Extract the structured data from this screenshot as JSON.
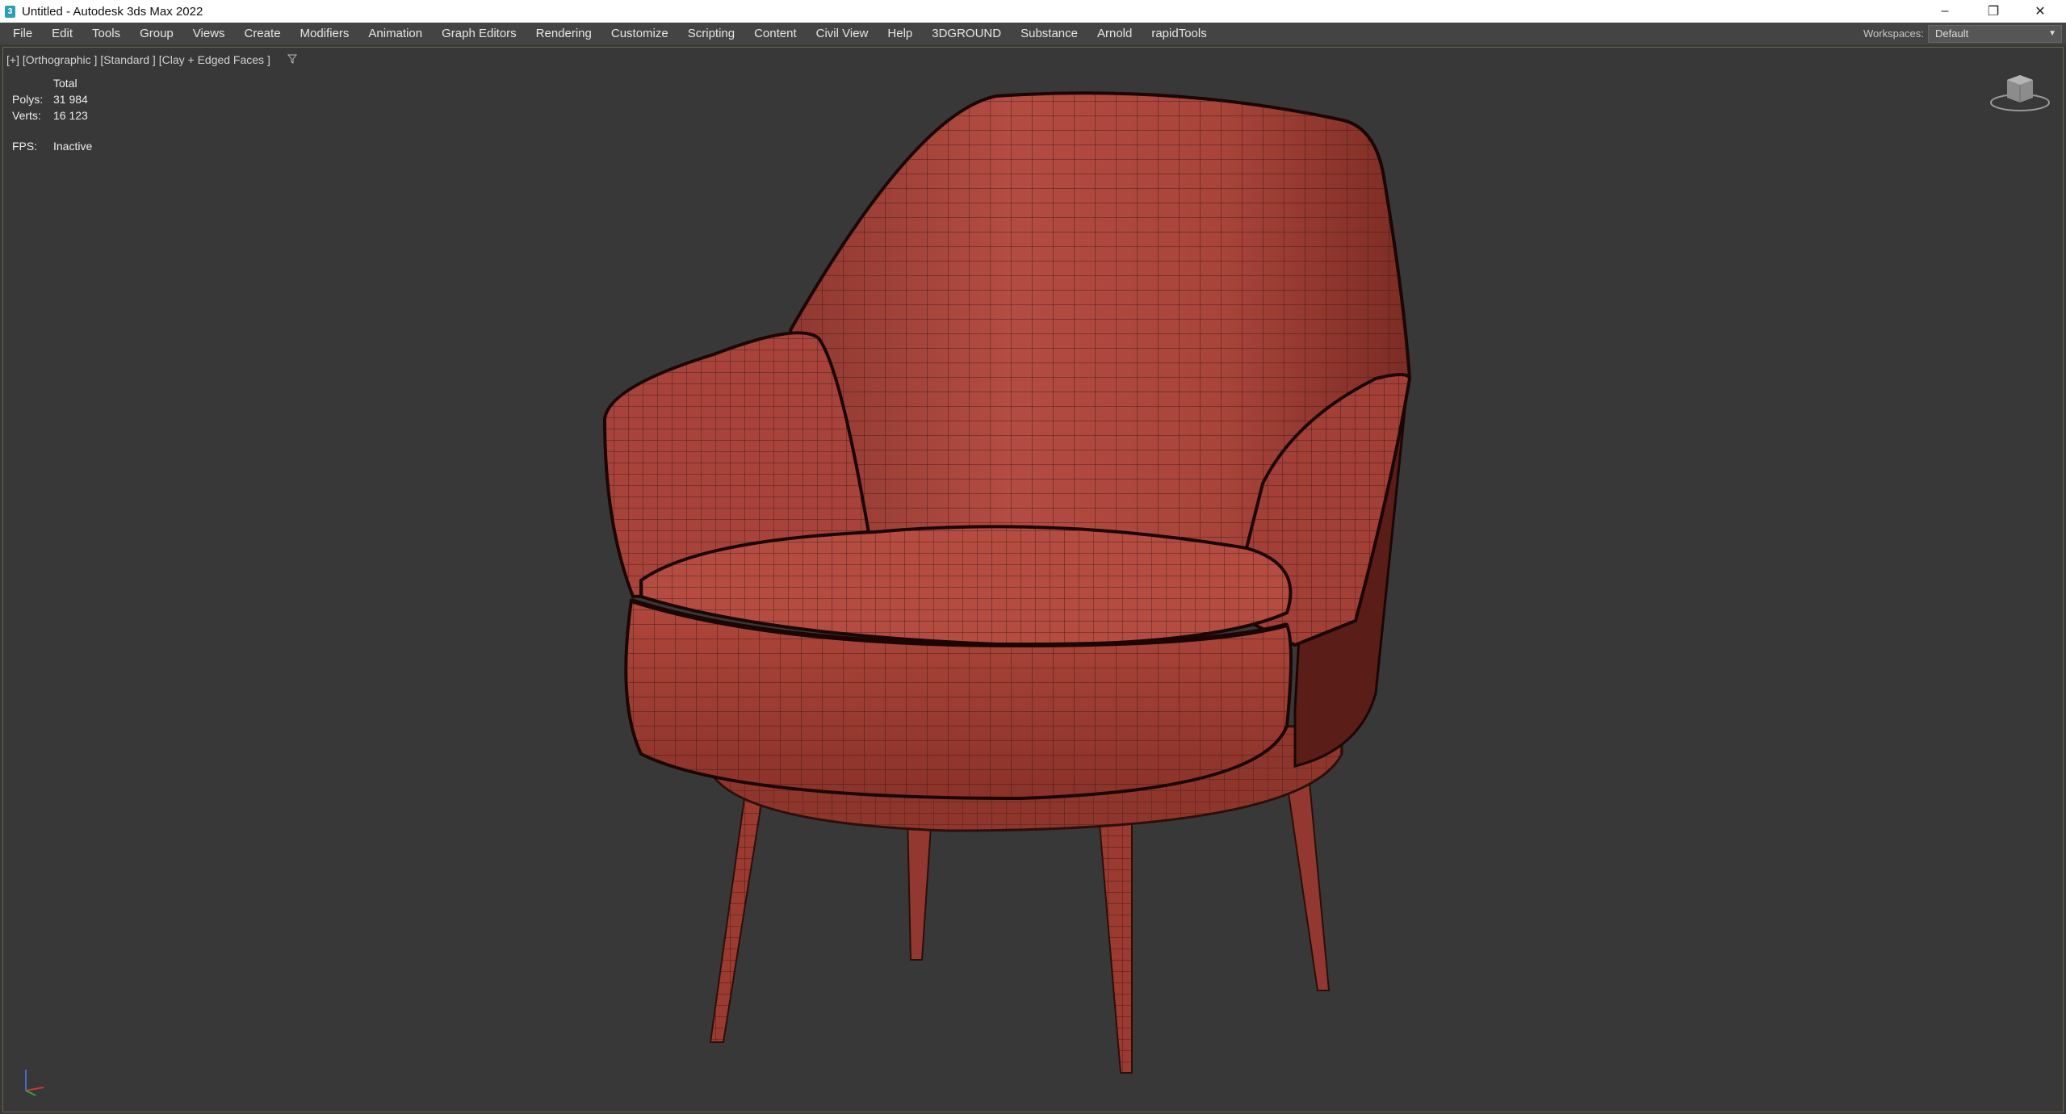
{
  "window": {
    "title": "Untitled - Autodesk 3ds Max 2022",
    "controls": {
      "minimize": "–",
      "restore": "❐",
      "close": "✕"
    }
  },
  "menu": [
    "File",
    "Edit",
    "Tools",
    "Group",
    "Views",
    "Create",
    "Modifiers",
    "Animation",
    "Graph Editors",
    "Rendering",
    "Customize",
    "Scripting",
    "Content",
    "Civil View",
    "Help",
    "3DGROUND",
    "Substance",
    "Arnold",
    "rapidTools"
  ],
  "workspaces": {
    "label": "Workspaces:",
    "value": "Default"
  },
  "viewport": {
    "label": "[+] [Orthographic ] [Standard ] [Clay + Edged Faces ]",
    "stats": {
      "header": "Total",
      "polys_label": "Polys:",
      "polys_value": "31 984",
      "verts_label": "Verts:",
      "verts_value": "16 123",
      "fps_label": "FPS:",
      "fps_value": "Inactive"
    }
  },
  "icons": [
    "app-icon",
    "filter-icon",
    "viewcube-icon",
    "axis-tripod-icon",
    "chevron-down-icon"
  ],
  "colors": {
    "viewport_bg": "#383838",
    "menubar_bg": "#444444",
    "mesh_fill": "#a8443a",
    "mesh_wire": "#2a0f0b",
    "active_border": "#6b6542"
  }
}
